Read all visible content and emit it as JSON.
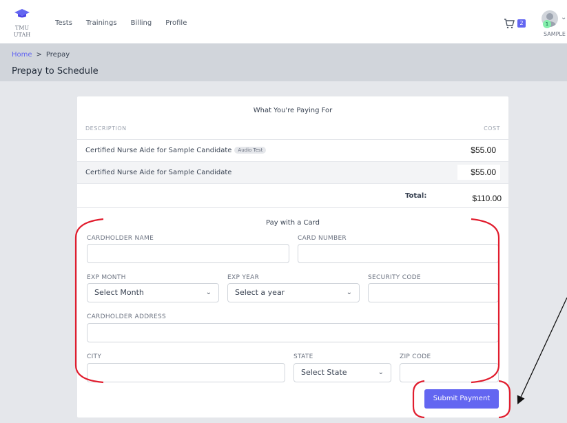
{
  "brand": {
    "line1": "TMU",
    "line2": "UTAH"
  },
  "nav": [
    "Tests",
    "Trainings",
    "Billing",
    "Profile"
  ],
  "cart": {
    "count": "2"
  },
  "user": {
    "badge": "1",
    "name": "SAMPLE"
  },
  "breadcrumb": {
    "home": "Home",
    "separator": ">",
    "current": "Prepay"
  },
  "page_title": "Prepay to Schedule",
  "summary": {
    "title": "What You're Paying For",
    "col_description": "DESCRIPTION",
    "col_cost": "COST",
    "items": [
      {
        "description": "Certified Nurse Aide for Sample Candidate",
        "tag": "Audio Test",
        "cost": "$55.00"
      },
      {
        "description": "Certified Nurse Aide for Sample Candidate",
        "tag": "",
        "cost": "$55.00"
      }
    ],
    "total_label": "Total:",
    "total_value": "$110.00"
  },
  "payment": {
    "title": "Pay with a Card",
    "cardholder_name": "CARDHOLDER NAME",
    "card_number": "CARD NUMBER",
    "exp_month": "EXP MONTH",
    "exp_month_value": "Select Month",
    "exp_year": "EXP YEAR",
    "exp_year_value": "Select a year",
    "security_code": "SECURITY CODE",
    "cardholder_address": "CARDHOLDER ADDRESS",
    "city": "CITY",
    "state": "STATE",
    "state_value": "Select State",
    "zip": "ZIP CODE",
    "submit": "Submit Payment"
  },
  "colors": {
    "accent": "#6366f1",
    "annotation": "#e11d2e"
  }
}
